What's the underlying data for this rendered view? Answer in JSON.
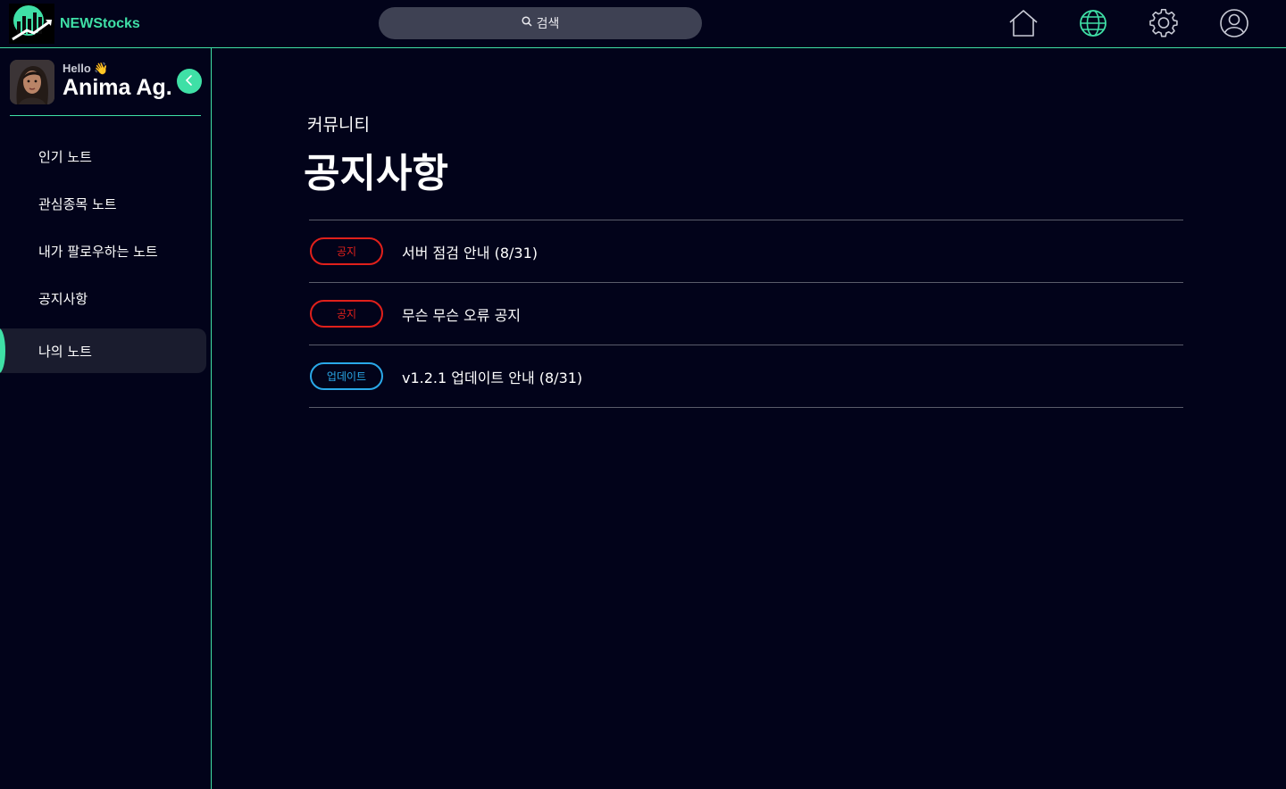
{
  "app": {
    "name": "NEWStocks",
    "accent_color": "#3fe0a6"
  },
  "search": {
    "label": "검색",
    "icon": "search-icon"
  },
  "topnav": {
    "icons": [
      "home-icon",
      "globe-icon",
      "gear-icon",
      "user-circle-icon"
    ]
  },
  "profile": {
    "greeting": "Hello",
    "greeting_emoji": "👋",
    "name": "Anima Ag."
  },
  "sidebar": {
    "items": [
      {
        "label": "인기 노트",
        "active": false
      },
      {
        "label": "관심종목 노트",
        "active": false
      },
      {
        "label": "내가 팔로우하는 노트",
        "active": false
      },
      {
        "label": "공지사항",
        "active": false
      },
      {
        "label": "나의 노트",
        "active": true
      }
    ]
  },
  "main": {
    "category": "커뮤니티",
    "title": "공지사항",
    "notices": [
      {
        "badge": "공지",
        "badge_type": "notice",
        "title": "서버 점검 안내 (8/31)"
      },
      {
        "badge": "공지",
        "badge_type": "notice",
        "title": "무슨 무슨 오류 공지"
      },
      {
        "badge": "업데이트",
        "badge_type": "update",
        "title": "v1.2.1 업데이트 안내 (8/31)"
      }
    ]
  },
  "colors": {
    "background": "#02031a",
    "notice_badge": "#e0201b",
    "update_badge": "#2aa8e8",
    "active_nav_bg": "#1a1c2e"
  }
}
